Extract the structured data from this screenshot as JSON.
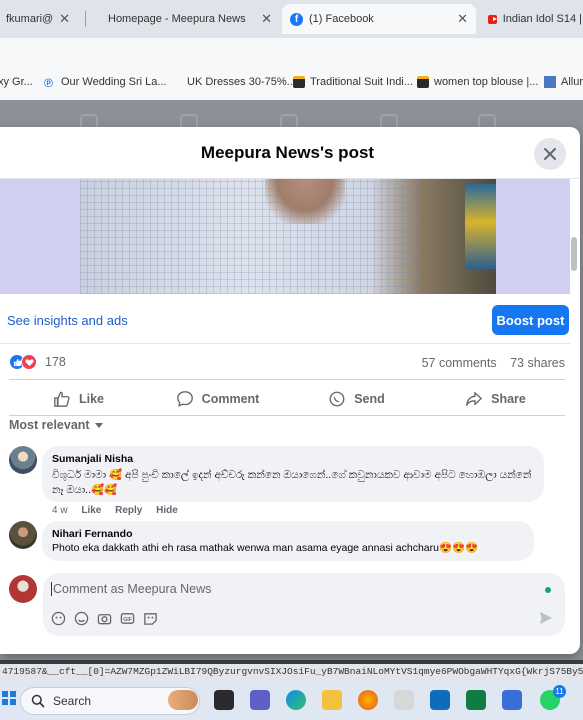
{
  "browser": {
    "tabs": [
      {
        "label": "fkumari@",
        "active": false
      },
      {
        "label": "Homepage - Meepura News",
        "active": false
      },
      {
        "label": "(1) Facebook",
        "active": true
      },
      {
        "label": "Indian Idol S14 |",
        "active": false
      }
    ],
    "bookmarks": [
      {
        "label": "xy Gr...",
        "icon": "page-icon"
      },
      {
        "label": "Our Wedding Sri La...",
        "icon": "pinterest-icon"
      },
      {
        "label": "UK Dresses 30-75%...",
        "icon": "none"
      },
      {
        "label": "Traditional Suit Indi...",
        "icon": "shopping-bag-icon"
      },
      {
        "label": "women top blouse |...",
        "icon": "shopping-bag-icon"
      },
      {
        "label": "Allur",
        "icon": "site-icon"
      }
    ],
    "status_url": "4719587&__cft__[0]=AZW7MZGp1ZWiLBI79QByzurgvnvSIXJOsiFu_yB7WBnaiNLoMYtVS1qmye6PWObgaWHTYqxG{WkrjS75By5JO4P3"
  },
  "dialog": {
    "title": "Meepura News's post",
    "insights_link": "See insights and ads",
    "boost_button": "Boost post",
    "reaction_count": "178",
    "comments_count": "57 comments",
    "shares_count": "73 shares",
    "actions": {
      "like": "Like",
      "comment": "Comment",
      "send": "Send",
      "share": "Share"
    },
    "sort_label": "Most relevant",
    "comments": [
      {
        "author": "Sumanjali Nisha",
        "text": "විශුධර් මාමා 🥰 අපි පුංචි කාලේ ඉදන් අච්චරු කන්නෙ ඔයාගෙන්..ගේ කවුනායකව ආවාම අපිට හොඹලා යන්නේ නෑ ඔයා..🥰🥰",
        "time": "4 w",
        "like": "Like",
        "reply": "Reply",
        "hide": "Hide"
      },
      {
        "author": "Nihari Fernando",
        "text": "Photo eka dakkath athi eh rasa mathak wenwa man asama eyage annasi achcharu😍😍😍"
      }
    ],
    "composer_placeholder": "Comment as Meepura News"
  },
  "taskbar": {
    "search_placeholder": "Search",
    "notification_badge": "11"
  },
  "colors": {
    "facebook_blue": "#1877f2",
    "love_red": "#f33e58"
  }
}
